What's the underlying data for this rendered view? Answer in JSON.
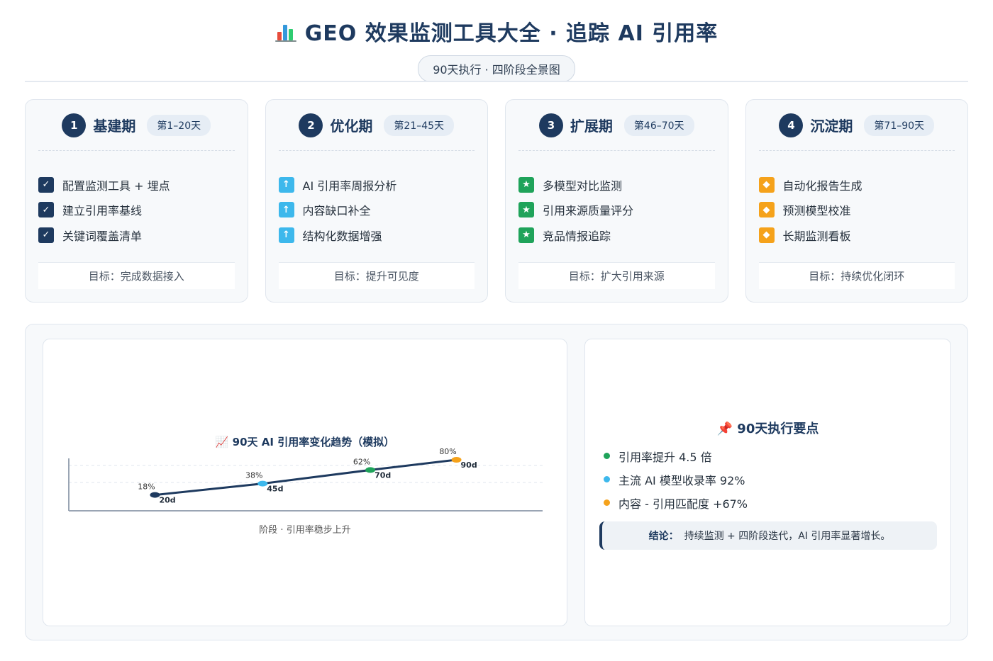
{
  "header": {
    "title": "GEO 效果监测工具大全 · 追踪 AI 引用率",
    "subtitle": "90天执行 · 四阶段全景图"
  },
  "phases": [
    {
      "num": "1",
      "name": "基建期",
      "days": "第1–20天",
      "mark": "✓",
      "mark_color": "#1e3a5f",
      "mark_icon": "check-icon",
      "items": [
        "配置监测工具 + 埋点",
        "建立引用率基线",
        "关键词覆盖清单"
      ],
      "goal": "目标：完成数据接入"
    },
    {
      "num": "2",
      "name": "优化期",
      "days": "第21–45天",
      "mark": "↑",
      "mark_color": "#3db8ec",
      "mark_icon": "arrow-up-icon",
      "items": [
        "AI 引用率周报分析",
        "内容缺口补全",
        "结构化数据增强"
      ],
      "goal": "目标：提升可见度"
    },
    {
      "num": "3",
      "name": "扩展期",
      "days": "第46–70天",
      "mark": "★",
      "mark_color": "#1fa35a",
      "mark_icon": "star-icon",
      "items": [
        "多模型对比监测",
        "引用来源质量评分",
        "竞品情报追踪"
      ],
      "goal": "目标：扩大引用来源"
    },
    {
      "num": "4",
      "name": "沉淀期",
      "days": "第71–90天",
      "mark": "◆",
      "mark_color": "#f5a21b",
      "mark_icon": "diamond-icon",
      "items": [
        "自动化报告生成",
        "预测模型校准",
        "长期监测看板"
      ],
      "goal": "目标：持续优化闭环"
    }
  ],
  "chart_data": {
    "type": "line",
    "title": "📈 90天 AI 引用率变化趋势（模拟）",
    "caption": "阶段 · 引用率稳步上升",
    "x": [
      "20d",
      "45d",
      "70d",
      "90d"
    ],
    "x_days": [
      20,
      45,
      70,
      90
    ],
    "values": [
      18,
      38,
      62,
      80
    ],
    "value_labels": [
      "18%",
      "38%",
      "62%",
      "80%"
    ],
    "point_colors": [
      "#1e3a5f",
      "#3db8ec",
      "#1fa35a",
      "#f5a21b"
    ],
    "line_color": "#1e3a5f",
    "xlabel": "",
    "ylabel": "",
    "xlim": [
      0,
      110
    ],
    "ylim": [
      -10,
      100
    ],
    "grid": true
  },
  "notes": {
    "title": "📌 90天执行要点",
    "items": [
      {
        "text": "引用率提升 4.5 倍",
        "color": "#1fa35a"
      },
      {
        "text": "主流 AI 模型收录率 92%",
        "color": "#3db8ec"
      },
      {
        "text": "内容 - 引用匹配度 +67%",
        "color": "#f5a21b"
      }
    ],
    "conclusion_label": "结论：",
    "conclusion_text": "持续监测 + 四阶段迭代，AI 引用率显著增长。"
  }
}
